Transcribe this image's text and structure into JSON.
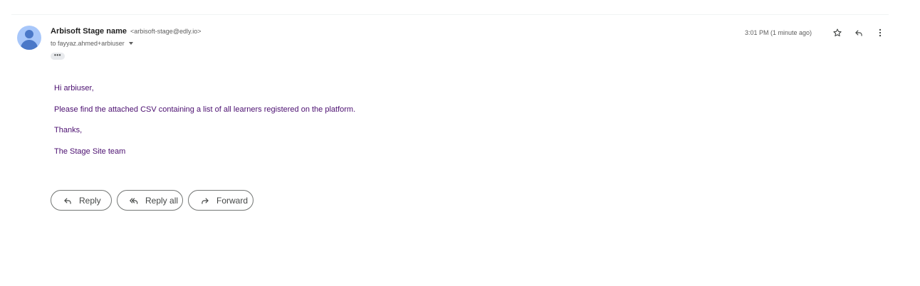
{
  "email": {
    "sender_name": "Arbisoft Stage name",
    "sender_email": "<arbisoft-stage@edly.io>",
    "to_line": "to fayyaz.ahmed+arbiuser",
    "collapsed_indicator": "•••",
    "timestamp": "3:01 PM (1 minute ago)",
    "body": [
      "Hi arbiuser,",
      "Please find the attached CSV containing a list of all learners registered on the platform.",
      "Thanks,",
      "The Stage Site team"
    ],
    "body_text_color": "#4b0f70"
  },
  "header_actions": {
    "star_icon": "star-icon",
    "reply_icon": "reply-icon",
    "more_icon": "more-vertical-icon"
  },
  "actions": {
    "reply_label": "Reply",
    "reply_all_label": "Reply all",
    "forward_label": "Forward"
  },
  "colors": {
    "avatar_bg": "#a8c7fa",
    "avatar_fg": "#4a78c8",
    "button_border": "#747775"
  }
}
